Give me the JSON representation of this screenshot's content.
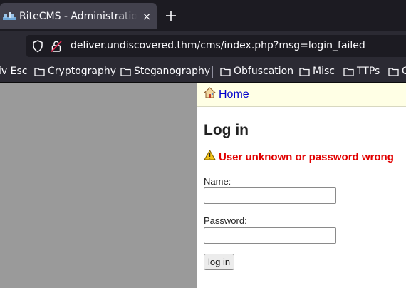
{
  "browser": {
    "tab_title": "RiteCMS - Administration",
    "tab_close_glyph": "×",
    "new_tab_glyph": "+",
    "url": "deliver.undiscovered.thm/cms/index.php?msg=login_failed"
  },
  "bookmarks": [
    {
      "label": "iv Esc",
      "folder": false
    },
    {
      "label": "Cryptography",
      "folder": true
    },
    {
      "label": "Steganography",
      "folder": true
    },
    {
      "label": "Obfuscation",
      "folder": true
    },
    {
      "label": "Misc",
      "folder": true
    },
    {
      "label": "TTPs",
      "folder": true
    },
    {
      "label": "C",
      "folder": true
    }
  ],
  "page": {
    "home_link": "Home",
    "login_heading": "Log in",
    "error_message": "User unknown or password wrong",
    "name_label": "Name:",
    "name_value": "",
    "password_label": "Password:",
    "password_value": "",
    "submit_label": "log in"
  },
  "colors": {
    "error": "#e10000",
    "link": "#0000cc",
    "home_bar_bg": "#ffffe5"
  }
}
